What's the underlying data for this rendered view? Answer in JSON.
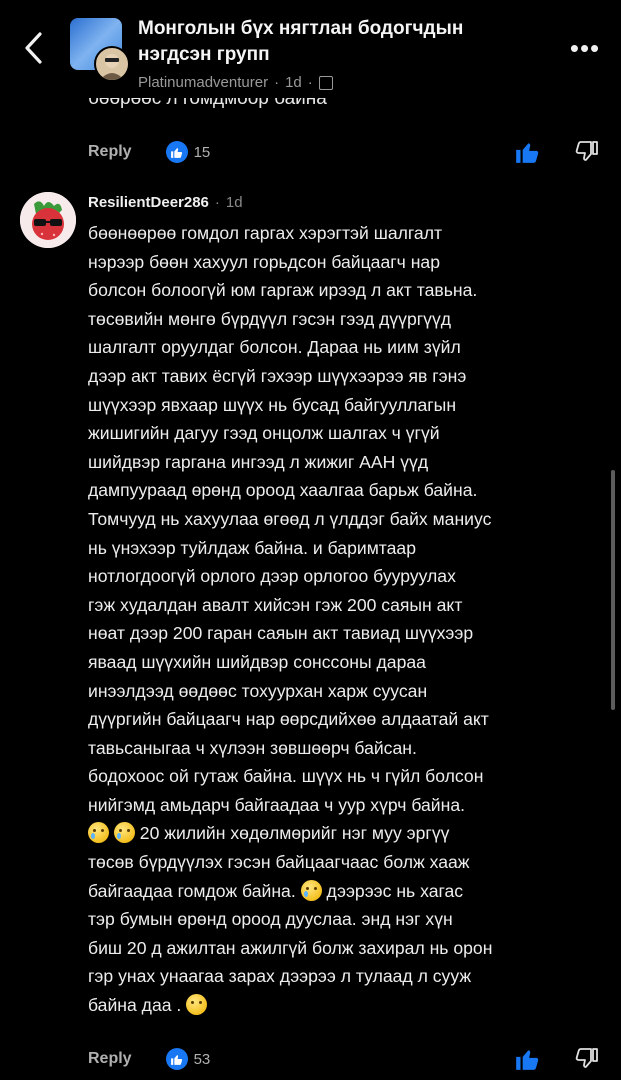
{
  "header": {
    "title_line1": "Монголын бүх нягтлан бодогчдын",
    "title_line2": "нэгдсэн групп",
    "author": "Platinumadventurer",
    "time": "1d",
    "more_label": "•••"
  },
  "previous_comment": {
    "cut_text": "бөөрөөс л гомдмоор байна",
    "reply_label": "Reply",
    "like_count": "15"
  },
  "comment": {
    "author": "ResilientDeer286",
    "time": "1d",
    "lines": [
      "бөөнөөрөө гомдол гаргах хэрэгтэй шалгалт",
      "нэрээр бөөн хахуул горьдсон байцаагч нар",
      "болсон болоогүй юм гаргаж ирээд л акт тавьна.",
      "төсөвийн мөнгө бүрдүүл гэсэн гээд дүүргүүд",
      "шалгалт оруулдаг болсон. Дараа нь иим зүйл",
      "дээр акт тавих ёсгүй гэхээр шүүхээрээ яв гэнэ",
      "шүүхээр явхаар шүүх нь бусад байгууллагын",
      "жишигийн дагуу гээд онцолж шалгах ч үгүй",
      "шийдвэр гаргана ингээд л жижиг ААН үүд",
      "дампуураад өрөнд ороод хаалгаа барьж байна.",
      "Томчууд нь хахуулаа өгөөд л үлддэг байх маниус",
      "нь үнэхээр туйлдаж байна. и баримтаар",
      "нотлогдоогүй орлого дээр орлогоо бууруулах",
      "гэж худалдан авалт хийсэн гэж 200 саяын акт",
      "нөат дээр 200 гаран саяын акт тавиад шүүхээр",
      "яваад шүүхийн шийдвэр сонссоны дараа",
      "инээлдээд өөдөөс тохуурхан харж суусан",
      "дүүргийн байцаагч нар өөрсдийхөө алдаатай акт",
      "тавьсаныгаа ч хүлээн зөвшөөрч байсан.",
      "бодохоос ой гутаж байна. шүүх нь ч гүйл болсон",
      "нийгэмд амьдарч байгаадаа ч уур хүрч байна."
    ],
    "line_22": "20 жилийн хөдөлмөрийг нэг муу эргүү",
    "line_23": "төсөв бүрдүүлэх гэсэн байцаагчаас болж хааж",
    "line_24a": "байгаадаа гомдож байна.",
    "line_24b": "дээрээс нь хагас",
    "line_25": "тэр бумын өрөнд ороод дууслаа.  энд нэг хүн",
    "line_26": "биш 20 д ажилтан ажилгүй болж захирал нь орон",
    "line_27": "гэр унах унаагаа зарах дээрээ л тулаад л сууж",
    "line_28": "байна даа .",
    "reply_label": "Reply",
    "like_count": "53"
  },
  "colors": {
    "background": "#000000",
    "like_blue": "#1877f2",
    "muted": "#9a9a9a"
  },
  "icons": [
    "back-arrow-icon",
    "globe-icon",
    "more-icon",
    "like-bubble-icon",
    "thumbs-up-icon",
    "thumbs-down-icon",
    "crying-emoji-icon",
    "sad-emoji-icon"
  ]
}
